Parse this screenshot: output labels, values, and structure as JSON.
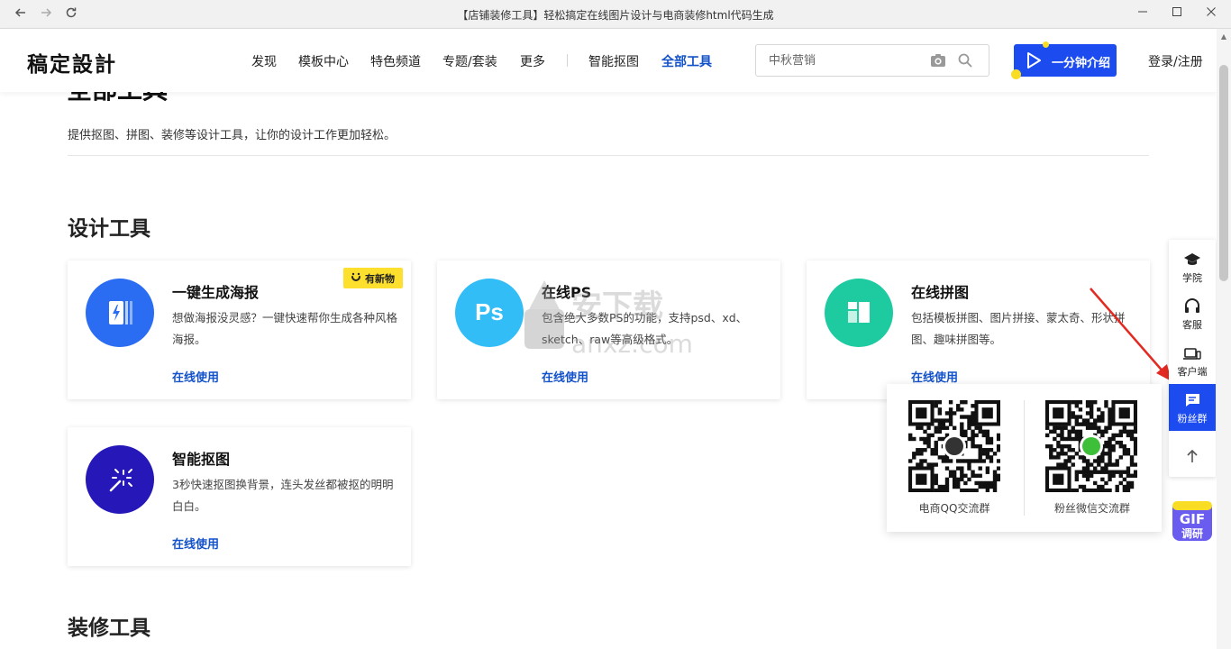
{
  "browser": {
    "title": "【店铺装修工具】轻松搞定在线图片设计与电商装修html代码生成",
    "back_icon": "arrow-left",
    "forward_icon": "arrow-right",
    "reload_icon": "refresh"
  },
  "header": {
    "logo": "稿定設計",
    "nav": [
      "发现",
      "模板中心",
      "特色频道",
      "专题/套装",
      "更多",
      "智能抠图",
      "全部工具"
    ],
    "active_nav": "全部工具",
    "search_placeholder": "中秋营销",
    "intro_button": "一分钟介绍",
    "login": "登录/注册",
    "accent_color": "#1c4cf0"
  },
  "page": {
    "scrolled_title": "全部工具",
    "subtitle": "提供抠图、拼图、装修等设计工具，让你的设计工作更加轻松。",
    "sections": [
      {
        "title": "设计工具",
        "cards": [
          {
            "title": "一键生成海报",
            "desc": "想做海报没灵感？一键快速帮你生成各种风格海报。",
            "link": "在线使用",
            "badge": "有新物",
            "icon": "poster-icon",
            "color": "#2a6df3"
          },
          {
            "title": "在线PS",
            "desc": "包含绝大多数PS的功能，支持psd、xd、sketch、raw等高级格式。",
            "link": "在线使用",
            "icon_text": "Ps",
            "color": "#33bdf6"
          },
          {
            "title": "在线拼图",
            "desc": "包括模板拼图、图片拼接、蒙太奇、形状拼图、趣味拼图等。",
            "link": "在线使用",
            "icon": "collage-icon",
            "color": "#1ecaa0"
          },
          {
            "title": "智能抠图",
            "desc": "3秒快速抠图换背景，连头发丝都被抠的明明白白。",
            "link": "在线使用",
            "icon": "magic-wand-icon",
            "color": "#2517b8"
          }
        ]
      },
      {
        "title": "装修工具"
      }
    ]
  },
  "sidebar": {
    "items": [
      "学院",
      "客服",
      "客户端",
      "粉丝群"
    ],
    "active": "粉丝群",
    "back_to_top_icon": "arrow-up"
  },
  "qr_popup": {
    "left_label": "电商QQ交流群",
    "right_label": "粉丝微信交流群"
  },
  "gif_badge": {
    "line1": "GIF",
    "line2": "调研"
  },
  "watermark": {
    "text": "安下载",
    "sub": "anxz.com"
  }
}
